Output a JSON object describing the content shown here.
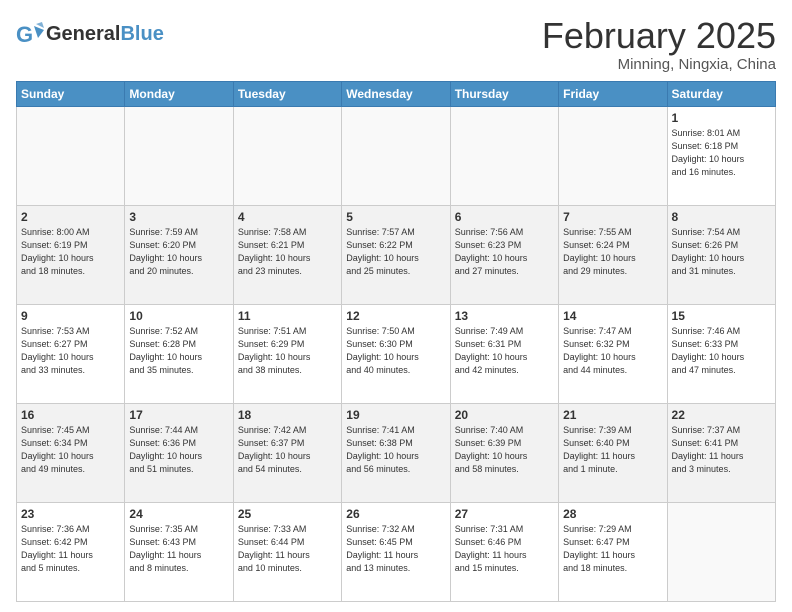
{
  "logo": {
    "text_general": "General",
    "text_blue": "Blue"
  },
  "header": {
    "month": "February 2025",
    "location": "Minning, Ningxia, China"
  },
  "weekdays": [
    "Sunday",
    "Monday",
    "Tuesday",
    "Wednesday",
    "Thursday",
    "Friday",
    "Saturday"
  ],
  "weeks": [
    [
      {
        "day": "",
        "info": ""
      },
      {
        "day": "",
        "info": ""
      },
      {
        "day": "",
        "info": ""
      },
      {
        "day": "",
        "info": ""
      },
      {
        "day": "",
        "info": ""
      },
      {
        "day": "",
        "info": ""
      },
      {
        "day": "1",
        "info": "Sunrise: 8:01 AM\nSunset: 6:18 PM\nDaylight: 10 hours\nand 16 minutes."
      }
    ],
    [
      {
        "day": "2",
        "info": "Sunrise: 8:00 AM\nSunset: 6:19 PM\nDaylight: 10 hours\nand 18 minutes."
      },
      {
        "day": "3",
        "info": "Sunrise: 7:59 AM\nSunset: 6:20 PM\nDaylight: 10 hours\nand 20 minutes."
      },
      {
        "day": "4",
        "info": "Sunrise: 7:58 AM\nSunset: 6:21 PM\nDaylight: 10 hours\nand 23 minutes."
      },
      {
        "day": "5",
        "info": "Sunrise: 7:57 AM\nSunset: 6:22 PM\nDaylight: 10 hours\nand 25 minutes."
      },
      {
        "day": "6",
        "info": "Sunrise: 7:56 AM\nSunset: 6:23 PM\nDaylight: 10 hours\nand 27 minutes."
      },
      {
        "day": "7",
        "info": "Sunrise: 7:55 AM\nSunset: 6:24 PM\nDaylight: 10 hours\nand 29 minutes."
      },
      {
        "day": "8",
        "info": "Sunrise: 7:54 AM\nSunset: 6:26 PM\nDaylight: 10 hours\nand 31 minutes."
      }
    ],
    [
      {
        "day": "9",
        "info": "Sunrise: 7:53 AM\nSunset: 6:27 PM\nDaylight: 10 hours\nand 33 minutes."
      },
      {
        "day": "10",
        "info": "Sunrise: 7:52 AM\nSunset: 6:28 PM\nDaylight: 10 hours\nand 35 minutes."
      },
      {
        "day": "11",
        "info": "Sunrise: 7:51 AM\nSunset: 6:29 PM\nDaylight: 10 hours\nand 38 minutes."
      },
      {
        "day": "12",
        "info": "Sunrise: 7:50 AM\nSunset: 6:30 PM\nDaylight: 10 hours\nand 40 minutes."
      },
      {
        "day": "13",
        "info": "Sunrise: 7:49 AM\nSunset: 6:31 PM\nDaylight: 10 hours\nand 42 minutes."
      },
      {
        "day": "14",
        "info": "Sunrise: 7:47 AM\nSunset: 6:32 PM\nDaylight: 10 hours\nand 44 minutes."
      },
      {
        "day": "15",
        "info": "Sunrise: 7:46 AM\nSunset: 6:33 PM\nDaylight: 10 hours\nand 47 minutes."
      }
    ],
    [
      {
        "day": "16",
        "info": "Sunrise: 7:45 AM\nSunset: 6:34 PM\nDaylight: 10 hours\nand 49 minutes."
      },
      {
        "day": "17",
        "info": "Sunrise: 7:44 AM\nSunset: 6:36 PM\nDaylight: 10 hours\nand 51 minutes."
      },
      {
        "day": "18",
        "info": "Sunrise: 7:42 AM\nSunset: 6:37 PM\nDaylight: 10 hours\nand 54 minutes."
      },
      {
        "day": "19",
        "info": "Sunrise: 7:41 AM\nSunset: 6:38 PM\nDaylight: 10 hours\nand 56 minutes."
      },
      {
        "day": "20",
        "info": "Sunrise: 7:40 AM\nSunset: 6:39 PM\nDaylight: 10 hours\nand 58 minutes."
      },
      {
        "day": "21",
        "info": "Sunrise: 7:39 AM\nSunset: 6:40 PM\nDaylight: 11 hours\nand 1 minute."
      },
      {
        "day": "22",
        "info": "Sunrise: 7:37 AM\nSunset: 6:41 PM\nDaylight: 11 hours\nand 3 minutes."
      }
    ],
    [
      {
        "day": "23",
        "info": "Sunrise: 7:36 AM\nSunset: 6:42 PM\nDaylight: 11 hours\nand 5 minutes."
      },
      {
        "day": "24",
        "info": "Sunrise: 7:35 AM\nSunset: 6:43 PM\nDaylight: 11 hours\nand 8 minutes."
      },
      {
        "day": "25",
        "info": "Sunrise: 7:33 AM\nSunset: 6:44 PM\nDaylight: 11 hours\nand 10 minutes."
      },
      {
        "day": "26",
        "info": "Sunrise: 7:32 AM\nSunset: 6:45 PM\nDaylight: 11 hours\nand 13 minutes."
      },
      {
        "day": "27",
        "info": "Sunrise: 7:31 AM\nSunset: 6:46 PM\nDaylight: 11 hours\nand 15 minutes."
      },
      {
        "day": "28",
        "info": "Sunrise: 7:29 AM\nSunset: 6:47 PM\nDaylight: 11 hours\nand 18 minutes."
      },
      {
        "day": "",
        "info": ""
      }
    ]
  ]
}
